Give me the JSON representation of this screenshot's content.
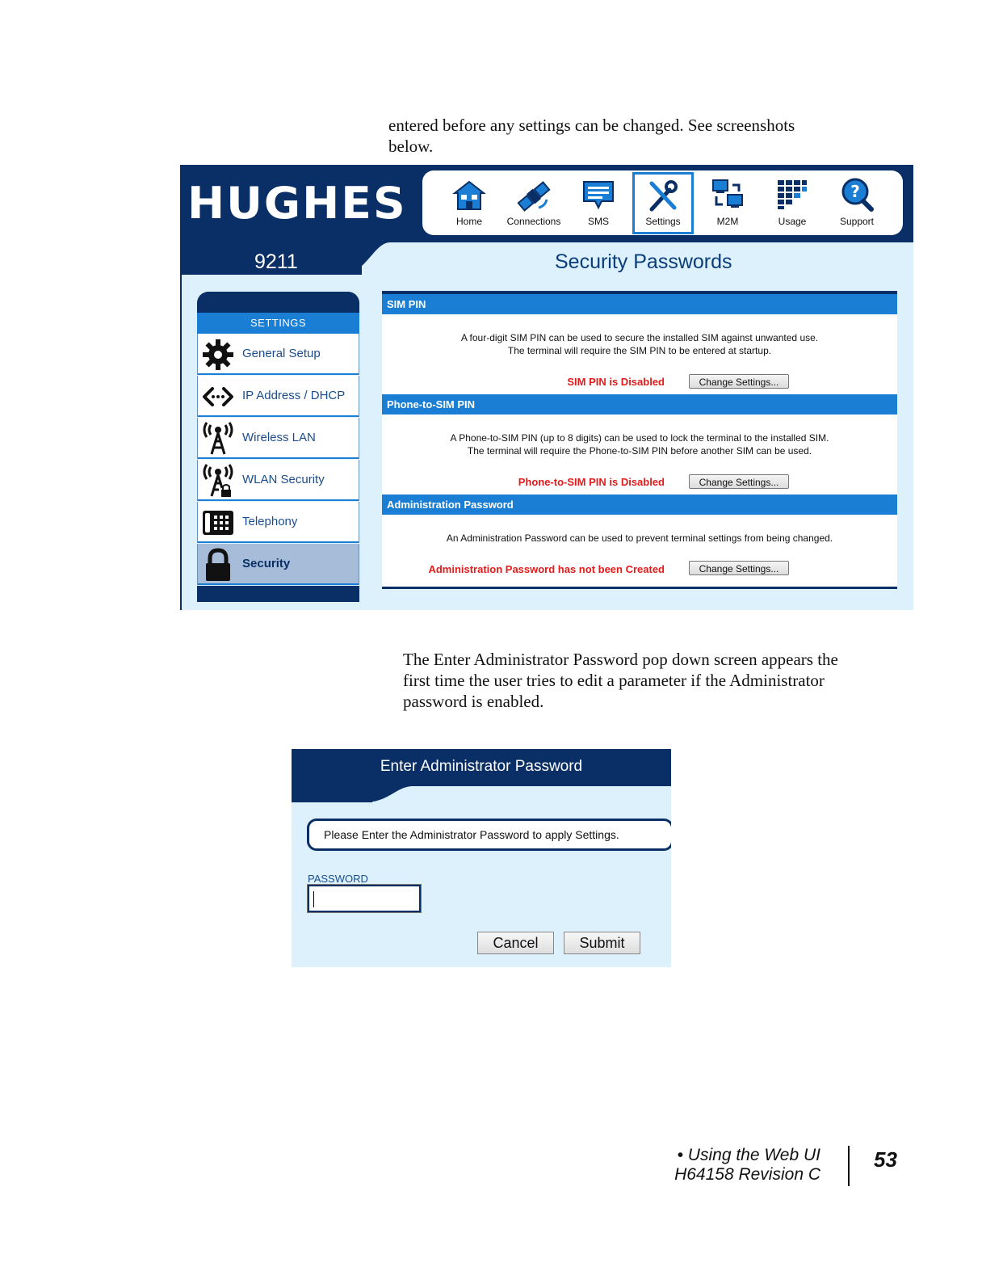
{
  "intro_text": "entered before any settings can be changed.  See screenshots below.",
  "webui": {
    "logo_text": "HUGHES",
    "model": "9211",
    "page_title": "Security Passwords",
    "nav": [
      {
        "label": "Home",
        "icon": "house-icon"
      },
      {
        "label": "Connections",
        "icon": "satellite-icon"
      },
      {
        "label": "SMS",
        "icon": "message-icon"
      },
      {
        "label": "Settings",
        "icon": "tools-icon",
        "active": true
      },
      {
        "label": "M2M",
        "icon": "computers-icon"
      },
      {
        "label": "Usage",
        "icon": "grid-chart-icon"
      },
      {
        "label": "Support",
        "icon": "help-magnifier-icon"
      }
    ],
    "sidebar": {
      "heading": "SETTINGS",
      "items": [
        {
          "label": "General Setup",
          "icon": "gear-icon"
        },
        {
          "label": "IP Address / DHCP",
          "icon": "arrows-icon"
        },
        {
          "label": "Wireless LAN",
          "icon": "antenna-icon"
        },
        {
          "label": "WLAN Security",
          "icon": "antenna-lock-icon"
        },
        {
          "label": "Telephony",
          "icon": "phone-icon"
        },
        {
          "label": "Security",
          "icon": "lock-icon",
          "active": true
        }
      ]
    },
    "sections": [
      {
        "title": "SIM PIN",
        "desc1": "A four-digit SIM PIN can be used to secure the installed SIM against unwanted use.",
        "desc2": "The terminal will require the SIM PIN to be entered at startup.",
        "status": "SIM PIN is Disabled",
        "button": "Change Settings..."
      },
      {
        "title": "Phone-to-SIM PIN",
        "desc1": "A Phone-to-SIM PIN (up to 8 digits) can be used to lock the terminal to the installed SIM.",
        "desc2": "The terminal will require the Phone-to-SIM PIN before another SIM can be used.",
        "status": "Phone-to-SIM PIN is Disabled",
        "button": "Change Settings..."
      },
      {
        "title": "Administration Password",
        "desc1": "An Administration Password can be used to prevent terminal settings from being changed.",
        "status": "Administration Password has not been Created",
        "button": "Change Settings..."
      }
    ],
    "colors": {
      "dark_navy": "#0a2f66",
      "accent_blue": "#1a7fd4",
      "status_red": "#e21b1b",
      "panel_bg": "#dcf1fb"
    }
  },
  "caption_text": "The Enter Administrator Password pop down screen appears the first time the user tries to edit a parameter if the Administrator password is enabled.",
  "popup": {
    "title": "Enter Administrator Password",
    "message": "Please Enter the Administrator Password to apply Settings.",
    "password_label": "PASSWORD",
    "password_value": "",
    "cancel_label": "Cancel",
    "submit_label": "Submit"
  },
  "footer": {
    "line1": "• Using the Web UI",
    "line2": "H64158  Revision C",
    "page_number": "53"
  }
}
